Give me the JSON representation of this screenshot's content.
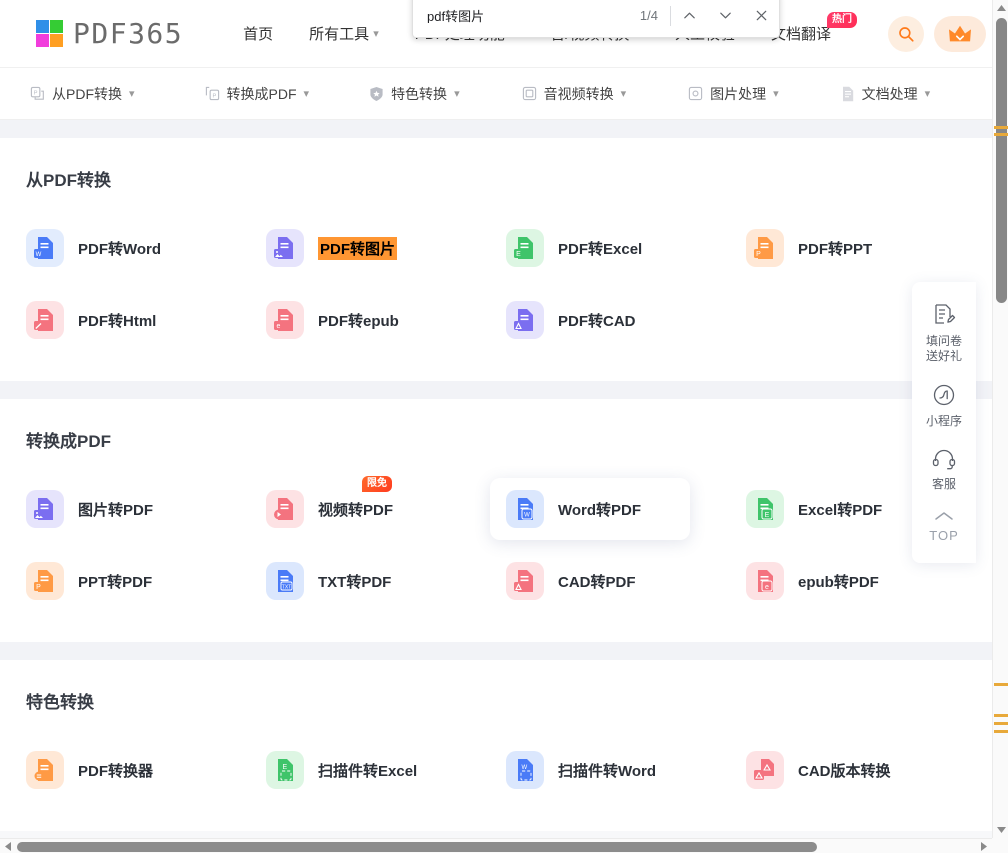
{
  "brand": {
    "name": "PDF365"
  },
  "top_nav": [
    {
      "label": "首页",
      "has_caret": false
    },
    {
      "label": "所有工具",
      "has_caret": true
    },
    {
      "label": "PDF处理功能",
      "has_caret": true
    },
    {
      "label": "音/视频转换",
      "has_caret": true
    },
    {
      "label": "人工校验",
      "has_caret": false
    },
    {
      "label": "文档翻译",
      "has_caret": false,
      "badge": "热门"
    }
  ],
  "header_actions": {
    "search_icon": "search-icon",
    "vip_icon": "crown-icon"
  },
  "sub_nav": [
    {
      "label": "从PDF转换",
      "icon": "pdf-convert-from-icon"
    },
    {
      "label": "转换成PDF",
      "icon": "pdf-convert-to-icon"
    },
    {
      "label": "特色转换",
      "icon": "star-shield-icon"
    },
    {
      "label": "音视频转换",
      "icon": "media-icon"
    },
    {
      "label": "图片处理",
      "icon": "image-icon"
    },
    {
      "label": "文档处理",
      "icon": "document-icon"
    }
  ],
  "sections": [
    {
      "title": "从PDF转换",
      "tools": [
        {
          "label": "PDF转Word",
          "icon_bg": "#e2ecfd",
          "icon_fg": "#4a7bf7",
          "tag": "W",
          "highlight": false,
          "hovered": false
        },
        {
          "label": "PDF转图片",
          "icon_bg": "#e6e4fc",
          "icon_fg": "#7b6ef0",
          "tag": "IM",
          "highlight": true,
          "hovered": false
        },
        {
          "label": "PDF转Excel",
          "icon_bg": "#ddf6e3",
          "icon_fg": "#3fc46a",
          "tag": "E",
          "highlight": false,
          "hovered": false
        },
        {
          "label": "PDF转PPT",
          "icon_bg": "#ffe8d6",
          "icon_fg": "#ff9a45",
          "tag": "P",
          "highlight": false,
          "hovered": false
        },
        {
          "label": "PDF转Html",
          "icon_bg": "#fde2e4",
          "icon_fg": "#f4737f",
          "tag": "H",
          "highlight": false,
          "hovered": false
        },
        {
          "label": "PDF转epub",
          "icon_bg": "#fde2e4",
          "icon_fg": "#f4737f",
          "tag": "e",
          "highlight": false,
          "hovered": false
        },
        {
          "label": "PDF转CAD",
          "icon_bg": "#e6e4fc",
          "icon_fg": "#7b6ef0",
          "tag": "D",
          "highlight": false,
          "hovered": false
        }
      ]
    },
    {
      "title": "转换成PDF",
      "tools": [
        {
          "label": "图片转PDF",
          "icon_bg": "#e6e4fc",
          "icon_fg": "#7b6ef0",
          "tag": "IM",
          "highlight": false,
          "hovered": false
        },
        {
          "label": "视频转PDF",
          "icon_bg": "#fde2e4",
          "icon_fg": "#f4737f",
          "tag": "V",
          "highlight": false,
          "hovered": false,
          "badge": "限免"
        },
        {
          "label": "Word转PDF",
          "icon_bg": "#dbe7fd",
          "icon_fg": "#4a7bf7",
          "tag": "W",
          "highlight": false,
          "hovered": true
        },
        {
          "label": "Excel转PDF",
          "icon_bg": "#ddf6e3",
          "icon_fg": "#3fc46a",
          "tag": "E",
          "highlight": false,
          "hovered": false
        },
        {
          "label": "PPT转PDF",
          "icon_bg": "#ffe8d6",
          "icon_fg": "#ff9a45",
          "tag": "P",
          "highlight": false,
          "hovered": false
        },
        {
          "label": "TXT转PDF",
          "icon_bg": "#dbe7fd",
          "icon_fg": "#4a7bf7",
          "tag": "TXT",
          "highlight": false,
          "hovered": false
        },
        {
          "label": "CAD转PDF",
          "icon_bg": "#fde2e4",
          "icon_fg": "#f4737f",
          "tag": "D",
          "highlight": false,
          "hovered": false
        },
        {
          "label": "epub转PDF",
          "icon_bg": "#fde2e4",
          "icon_fg": "#f4737f",
          "tag": "e",
          "highlight": false,
          "hovered": false
        }
      ]
    },
    {
      "title": "特色转换",
      "tools": [
        {
          "label": "PDF转换器",
          "icon_bg": "#ffe8d6",
          "icon_fg": "#ff9a45",
          "tag": "C",
          "highlight": false,
          "hovered": false
        },
        {
          "label": "扫描件转Excel",
          "icon_bg": "#ddf6e3",
          "icon_fg": "#3fc46a",
          "tag": "SE",
          "highlight": false,
          "hovered": false
        },
        {
          "label": "扫描件转Word",
          "icon_bg": "#dbe7fd",
          "icon_fg": "#4a7bf7",
          "tag": "SW",
          "highlight": false,
          "hovered": false
        },
        {
          "label": "CAD版本转换",
          "icon_bg": "#fde2e4",
          "icon_fg": "#f4737f",
          "tag": "DD",
          "highlight": false,
          "hovered": false
        }
      ]
    }
  ],
  "right_rail": [
    {
      "label1": "填问卷",
      "label2": "送好礼",
      "icon": "survey-icon"
    },
    {
      "label1": "小程序",
      "label2": "",
      "icon": "miniprogram-icon"
    },
    {
      "label1": "客服",
      "label2": "",
      "icon": "headset-icon"
    },
    {
      "label1": "TOP",
      "label2": "",
      "icon": "chevron-up-icon"
    }
  ],
  "find_bar": {
    "query": "pdf转图片",
    "placeholder": "",
    "counter": "1/4",
    "prev_icon": "chevron-up-icon",
    "next_icon": "chevron-down-icon",
    "close_icon": "close-icon"
  },
  "colors": {
    "accent_orange": "#ff7a1a",
    "highlight": "#ff9632",
    "page_bg": "#f2f3f7"
  }
}
